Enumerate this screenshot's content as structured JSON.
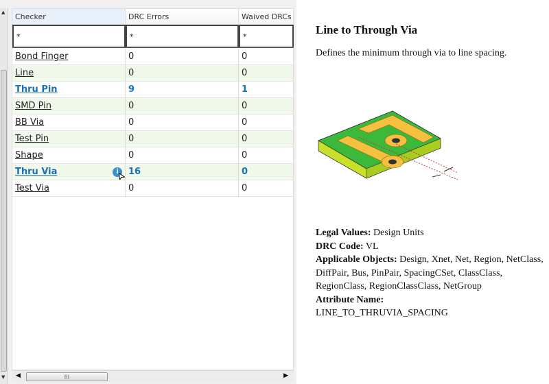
{
  "grid": {
    "headers": [
      "Checker",
      "DRC Errors",
      "Waived DRCs"
    ],
    "filters": [
      "*",
      "*",
      "*"
    ],
    "rows": [
      {
        "checker": "Bond Finger",
        "errors": "0",
        "waived": "0",
        "highlight": false
      },
      {
        "checker": "Line",
        "errors": "0",
        "waived": "0",
        "highlight": false
      },
      {
        "checker": "Thru Pin",
        "errors": "9",
        "waived": "1",
        "highlight": true
      },
      {
        "checker": "SMD Pin",
        "errors": "0",
        "waived": "0",
        "highlight": false
      },
      {
        "checker": "BB Via",
        "errors": "0",
        "waived": "0",
        "highlight": false
      },
      {
        "checker": "Test Pin",
        "errors": "0",
        "waived": "0",
        "highlight": false
      },
      {
        "checker": "Shape",
        "errors": "0",
        "waived": "0",
        "highlight": false
      },
      {
        "checker": "Thru Via",
        "errors": "16",
        "waived": "0",
        "highlight": true
      },
      {
        "checker": "Test Via",
        "errors": "0",
        "waived": "0",
        "highlight": false
      }
    ],
    "info_icon": "i",
    "scroll_grip": "⁞⁞⁞"
  },
  "detail": {
    "title": "Line to Through Via",
    "description": "Defines the minimum through via to line spacing.",
    "legal_values_label": "Legal Values:",
    "legal_values": "Design Units",
    "drc_code_label": "DRC Code:",
    "drc_code": "VL",
    "applicable_label": "Applicable Objects:",
    "applicable": "Design, Xnet, Net, Region, NetClass, DiffPair, Bus, PinPair, SpacingCSet, ClassClass, RegionClass, RegionClassClass, NetGroup",
    "attribute_label": "Attribute Name:",
    "attribute": "LINE_TO_THRUVIA_SPACING"
  },
  "colors": {
    "link_highlight": "#1a6fb8",
    "row_alt": "#f0f8ea"
  }
}
